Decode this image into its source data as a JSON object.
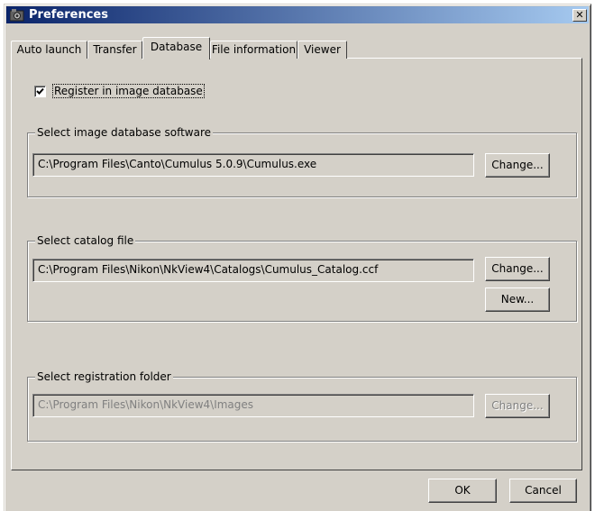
{
  "window": {
    "title": "Preferences",
    "close_glyph": "✕"
  },
  "tabs": [
    {
      "label": "Auto launch",
      "active": false
    },
    {
      "label": "Transfer",
      "active": false
    },
    {
      "label": "Database",
      "active": true
    },
    {
      "label": "File information",
      "active": false
    },
    {
      "label": "Viewer",
      "active": false
    }
  ],
  "register": {
    "label": "Register in image database",
    "checked": true
  },
  "software_group": {
    "legend": "Select image database software",
    "path": "C:\\Program Files\\Canto\\Cumulus 5.0.9\\Cumulus.exe",
    "change_label": "Change..."
  },
  "catalog_group": {
    "legend": "Select catalog file",
    "path": "C:\\Program Files\\Nikon\\NkView4\\Catalogs\\Cumulus_Catalog.ccf",
    "change_label": "Change...",
    "new_label": "New..."
  },
  "folder_group": {
    "legend": "Select registration folder",
    "path": "C:\\Program Files\\Nikon\\NkView4\\Images",
    "change_label": "Change...",
    "enabled": false
  },
  "footer": {
    "ok_label": "OK",
    "cancel_label": "Cancel"
  }
}
